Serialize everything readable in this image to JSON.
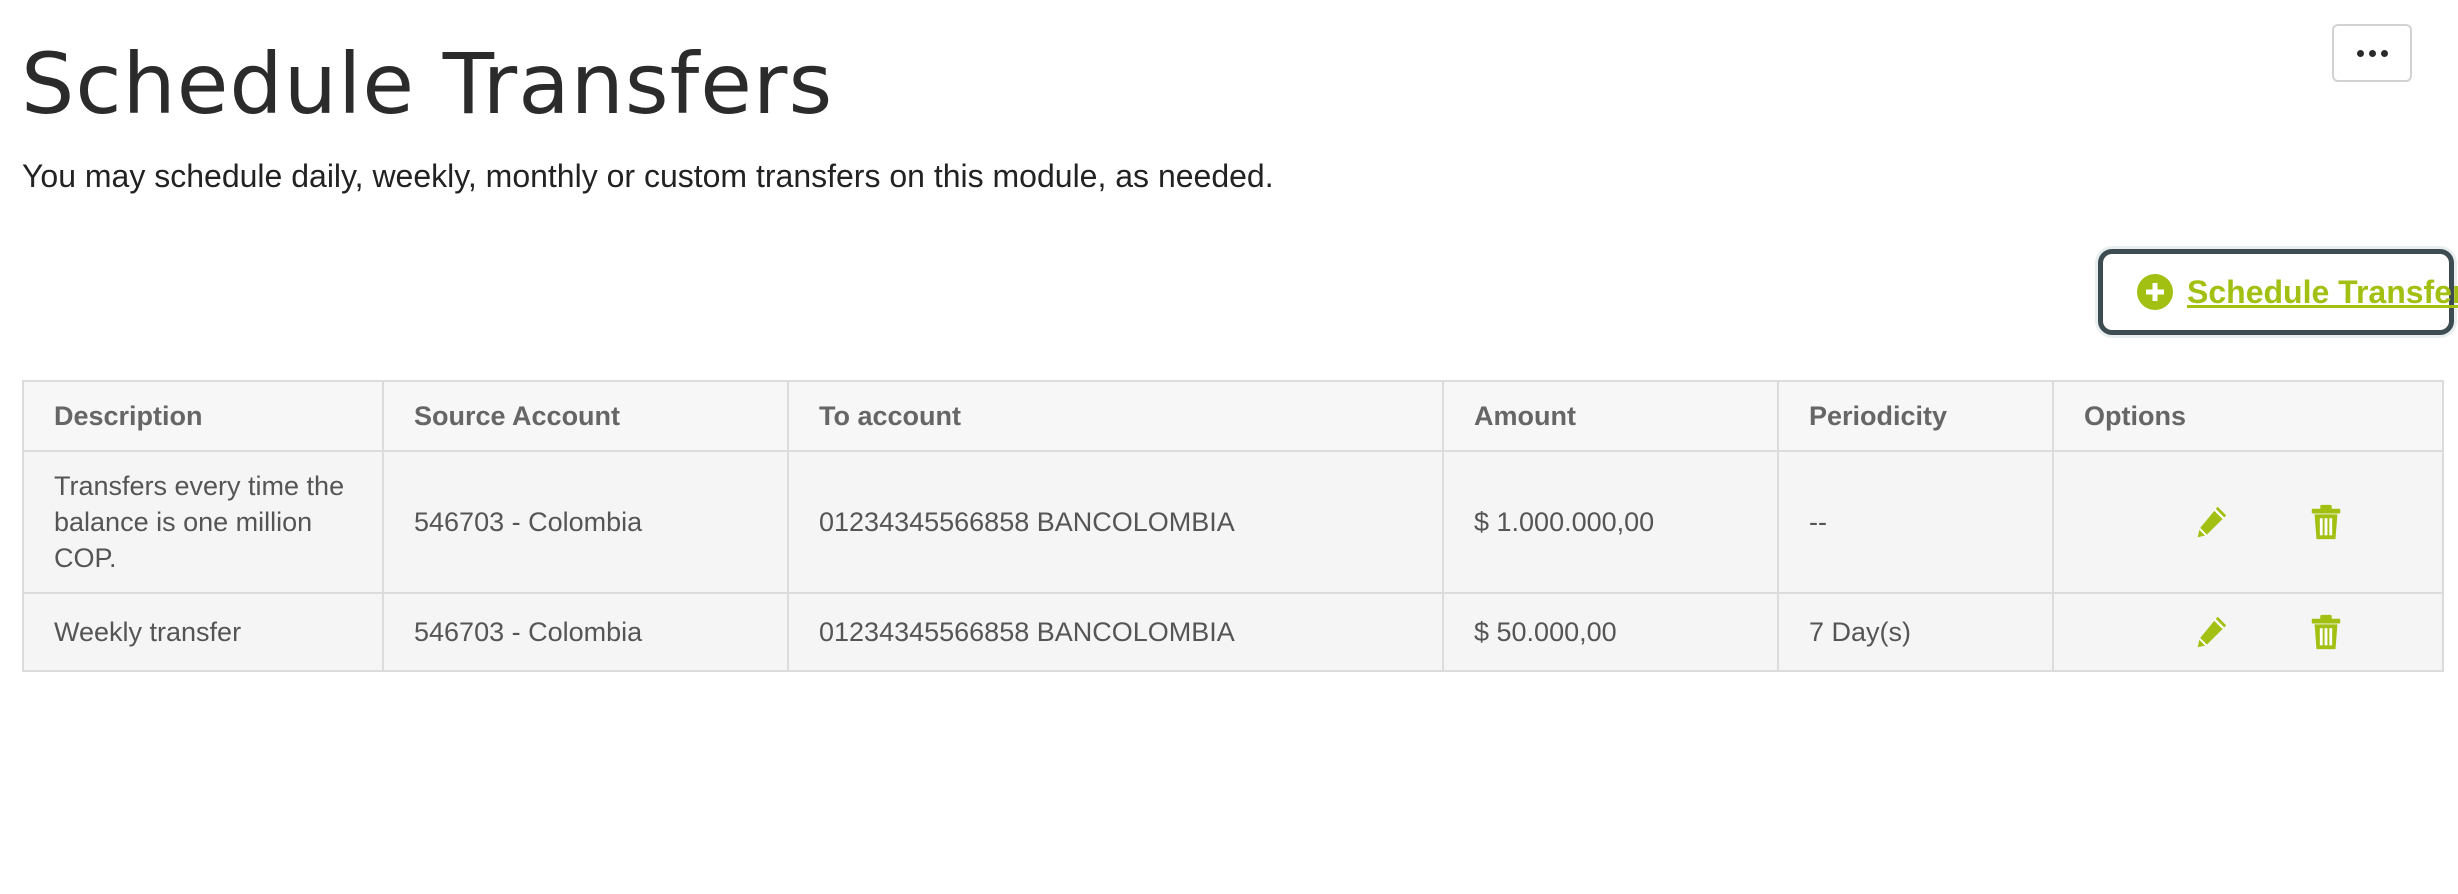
{
  "header": {
    "title": "Schedule Transfers",
    "subtitle": "You may schedule daily, weekly, monthly or custom transfers on this module, as needed."
  },
  "toolbar": {
    "more_icon": "ellipsis-icon",
    "schedule_button_label": "Schedule Transfer",
    "schedule_button_icon": "plus-circle-icon"
  },
  "table": {
    "columns": [
      "Description",
      "Source Account",
      "To account",
      "Amount",
      "Periodicity",
      "Options"
    ],
    "rows": [
      {
        "description": "Transfers every time the balance is one million COP.",
        "source": "546703 - Colombia",
        "to": "01234345566858 BANCOLOMBIA",
        "amount": "$ 1.000.000,00",
        "periodicity": "--"
      },
      {
        "description": "Weekly transfer",
        "source": "546703 - Colombia",
        "to": "01234345566858 BANCOLOMBIA",
        "amount": "$ 50.000,00",
        "periodicity": "7 Day(s)"
      }
    ],
    "option_icons": [
      "pencil-icon",
      "trash-icon"
    ]
  },
  "colors": {
    "accent": "#a1c011",
    "focus_border": "#3d4b52",
    "title_text": "#2b2b2b",
    "table_border": "#dcdcdc"
  }
}
